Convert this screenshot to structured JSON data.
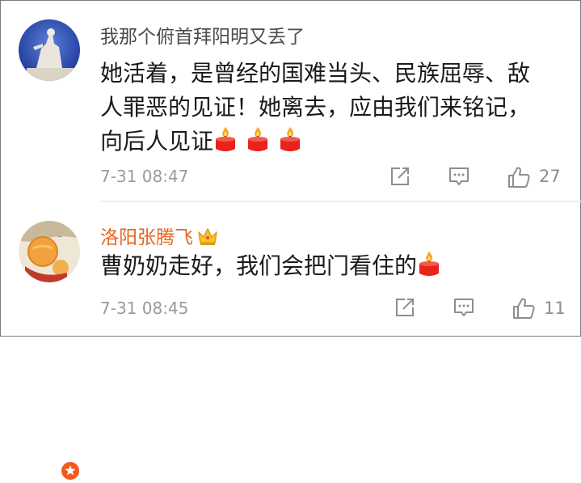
{
  "comments": [
    {
      "username": "我那个俯首拜阳明又丢了",
      "text_lines": [
        "她活着，是曾经的国难当头、民族屈辱、敌",
        "人罪恶的见证！她离去，应由我们来铭记，",
        "向后人见证"
      ],
      "candles": 3,
      "time": "7-31 08:47",
      "likes": "27"
    },
    {
      "username": "洛阳张腾飞",
      "text": "曹奶奶走好，我们会把门看住的",
      "candles": 1,
      "time": "7-31 08:45",
      "likes": "11"
    }
  ],
  "colors": {
    "vip_username": "#e8641e",
    "candle": "#e8231b",
    "flame": "#f7a51c",
    "verify_badge": "#f25a1e",
    "icon_gray": "#8e8e8e"
  },
  "icons": [
    "repost-icon",
    "comment-icon",
    "like-icon",
    "candle-emoji",
    "crown-icon",
    "verified-badge-icon"
  ]
}
